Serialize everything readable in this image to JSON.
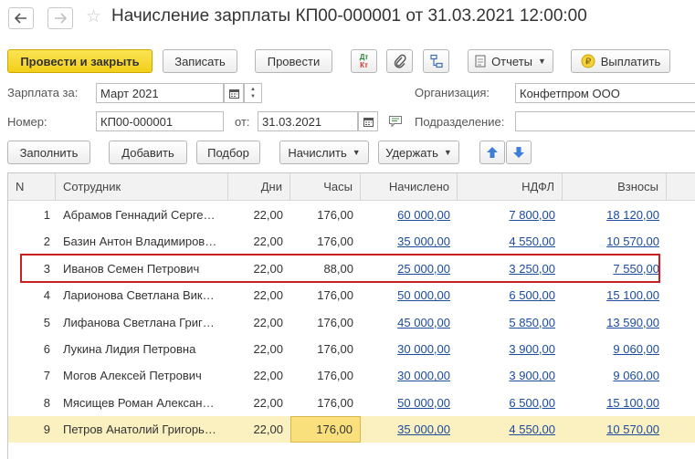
{
  "window": {
    "title": "Начисление зарплаты КП00-000001 от 31.03.2021 12:00:00"
  },
  "toolbar": {
    "post_close": "Провести и закрыть",
    "save": "Записать",
    "post": "Провести",
    "dt_kt_top": "Дт",
    "dt_kt_bottom": "Кт",
    "reports": "Отчеты",
    "pay": "Выплатить"
  },
  "form": {
    "salary_for_label": "Зарплата за:",
    "salary_for_value": "Март 2021",
    "number_label": "Номер:",
    "number_value": "КП00-000001",
    "date_label": "от:",
    "date_value": "31.03.2021",
    "organization_label": "Организация:",
    "organization_value": "Конфетпром ООО",
    "department_label": "Подразделение:",
    "department_value": ""
  },
  "table_toolbar": {
    "fill": "Заполнить",
    "add": "Добавить",
    "selection": "Подбор",
    "accrue": "Начислить",
    "withhold": "Удержать"
  },
  "table": {
    "columns": [
      "N",
      "Сотрудник",
      "Дни",
      "Часы",
      "Начислено",
      "НДФЛ",
      "Взносы"
    ],
    "rows": [
      {
        "n": "1",
        "employee": "Абрамов Геннадий Серге…",
        "days": "22,00",
        "hours": "176,00",
        "accrued": "60 000,00",
        "ndfl": "7 800,00",
        "contrib": "18 120,00"
      },
      {
        "n": "2",
        "employee": "Базин Антон Владимиров…",
        "days": "22,00",
        "hours": "176,00",
        "accrued": "35 000,00",
        "ndfl": "4 550,00",
        "contrib": "10 570,00"
      },
      {
        "n": "3",
        "employee": "Иванов Семен Петрович",
        "days": "22,00",
        "hours": "88,00",
        "accrued": "25 000,00",
        "ndfl": "3 250,00",
        "contrib": "7 550,00"
      },
      {
        "n": "4",
        "employee": "Ларионова Светлана Вик…",
        "days": "22,00",
        "hours": "176,00",
        "accrued": "50 000,00",
        "ndfl": "6 500,00",
        "contrib": "15 100,00"
      },
      {
        "n": "5",
        "employee": "Лифанова Светлана Григ…",
        "days": "22,00",
        "hours": "176,00",
        "accrued": "45 000,00",
        "ndfl": "5 850,00",
        "contrib": "13 590,00"
      },
      {
        "n": "6",
        "employee": "Лукина Лидия Петровна",
        "days": "22,00",
        "hours": "176,00",
        "accrued": "30 000,00",
        "ndfl": "3 900,00",
        "contrib": "9 060,00"
      },
      {
        "n": "7",
        "employee": "Могов Алексей Петрович",
        "days": "22,00",
        "hours": "176,00",
        "accrued": "30 000,00",
        "ndfl": "3 900,00",
        "contrib": "9 060,00"
      },
      {
        "n": "8",
        "employee": "Мясищев Роман Алексан…",
        "days": "22,00",
        "hours": "176,00",
        "accrued": "50 000,00",
        "ndfl": "6 500,00",
        "contrib": "15 100,00"
      },
      {
        "n": "9",
        "employee": "Петров Анатолий Григорь…",
        "days": "22,00",
        "hours": "176,00",
        "accrued": "35 000,00",
        "ndfl": "4 550,00",
        "contrib": "10 570,00"
      }
    ]
  },
  "colors": {
    "primary_button": "#f3cf1b",
    "link": "#1c4ba0",
    "selected_row": "#fbf0c0",
    "highlight_frame": "#cc1f1f",
    "arrow_blue": "#3d7fd6"
  }
}
